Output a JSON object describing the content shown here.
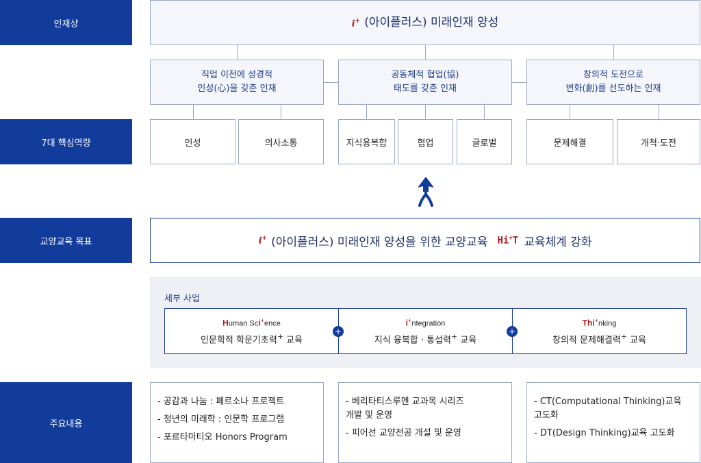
{
  "rows": {
    "talent": "인재상",
    "competency": "7대 핵심역량",
    "goal": "교양교육 목표",
    "content": "주요내용"
  },
  "talent_title": "(아이플러스) 미래인재 양성",
  "talents": [
    {
      "line1": "직업 이전에 성경적",
      "line2": "인성(心)을 갖춘 인재"
    },
    {
      "line1": "공동체적 협업(協)",
      "line2": "태도를 갖춘 인재"
    },
    {
      "line1": "창의적 도전으로",
      "line2": "변화(創)를 선도하는 인재"
    }
  ],
  "competencies": [
    "인성",
    "의사소통",
    "지식융복합",
    "협업",
    "글로벌",
    "문제해결",
    "개척·도전"
  ],
  "goal_text_1": "(아이플러스) 미래인재 양성을 위한 교양교육",
  "goal_text_2": "교육체계 강화",
  "logos": {
    "i": "i",
    "plus": "+",
    "hit_h": "Hi",
    "hit_t": "T"
  },
  "detail_label": "세부 사업",
  "details": [
    {
      "logo_cap": "H",
      "logo_a": "uman Sc",
      "logo_b": "ence",
      "desc": "인문학적 학문기초력"
    },
    {
      "logo_cap": "i",
      "logo_a": "",
      "logo_b": "ntegration",
      "desc": "지식 융복합 · 통섭력"
    },
    {
      "logo_cap": "Th",
      "logo_a": "",
      "logo_b": "nking",
      "desc": "창의적 문제해결력"
    }
  ],
  "detail_suffix": "교육",
  "contents": [
    [
      "- 공감과 나눔 : 페르소나 프로젝트",
      "- 청년의 미래학 : 인문학 프로그램",
      "- 포르타마티오 Honors Program"
    ],
    [
      "- 베리타티스루멘 교과목 시리즈\n  개발 및 운영",
      "- 피어선 교양전공 개설 및 운영"
    ],
    [
      "- CT(Computational Thinking)교육\n  고도화",
      "- DT(Design Thinking)교육 고도화"
    ]
  ],
  "colors": {
    "navy": "#123c9c",
    "red": "#b2191c",
    "border": "#9aa7c4"
  }
}
